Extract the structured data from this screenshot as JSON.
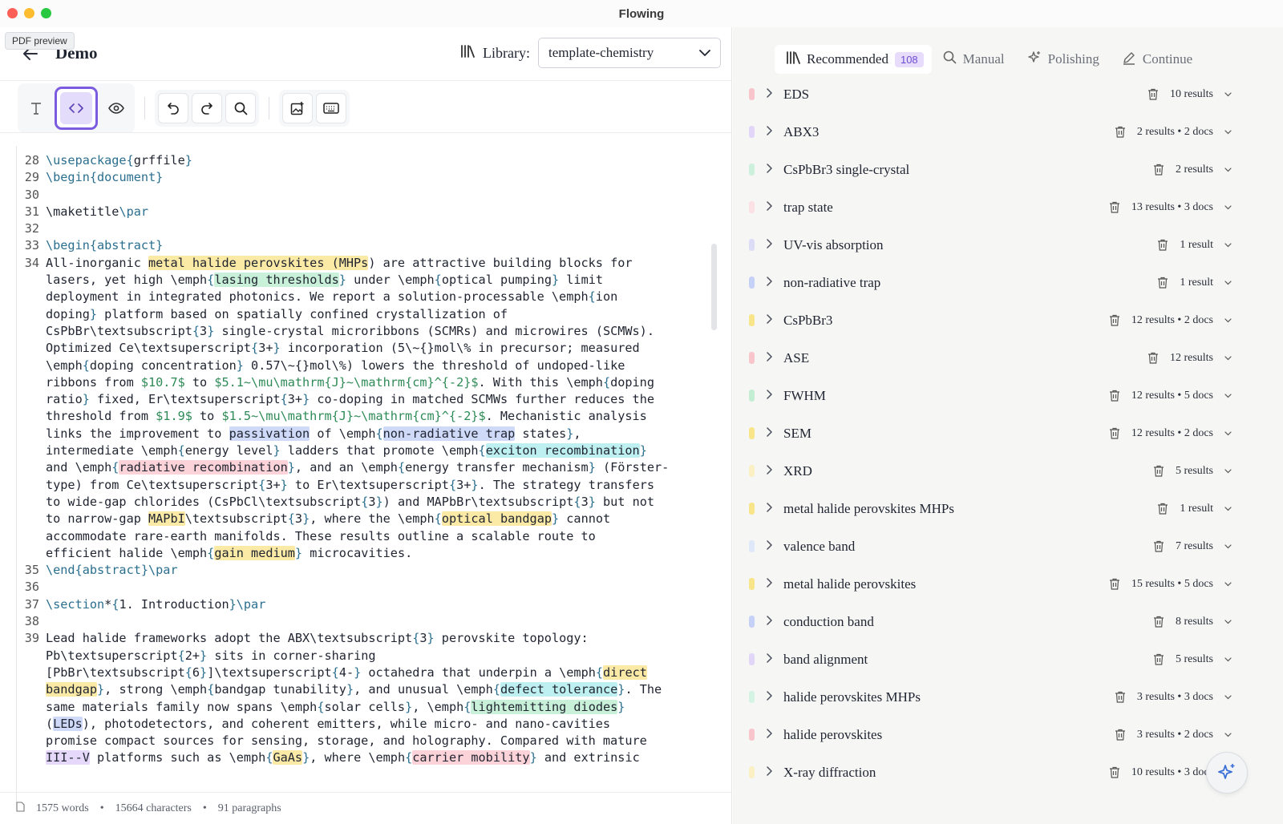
{
  "window": {
    "title": "Flowing"
  },
  "tooltip": "PDF preview",
  "header": {
    "title": "Demo",
    "library_label": "Library:",
    "library_value": "template-chemistry"
  },
  "status": {
    "words": "1575 words",
    "characters": "15664 characters",
    "paragraphs": "91 paragraphs",
    "separator": "•"
  },
  "tabs": [
    {
      "label": "Recommended",
      "badge": "108",
      "icon": "library-icon"
    },
    {
      "label": "Manual",
      "icon": "search-icon"
    },
    {
      "label": "Polishing",
      "icon": "sparkles-icon"
    },
    {
      "label": "Continue",
      "icon": "pen-icon"
    }
  ],
  "terms": [
    {
      "name": "EDS",
      "meta": "10 results",
      "color": "#f7c5cb"
    },
    {
      "name": "ABX3",
      "meta": "2 results • 2 docs",
      "color": "#e2d6f8"
    },
    {
      "name": "CsPbBr3 single-crystal",
      "meta": "2 results",
      "color": "#cdf0dc"
    },
    {
      "name": "trap state",
      "meta": "13 results • 3 docs",
      "color": "#fbe0e4"
    },
    {
      "name": "UV-vis absorption",
      "meta": "1 result",
      "color": "#dcdcf7"
    },
    {
      "name": "non-radiative trap",
      "meta": "1 result",
      "color": "#c5d1f6"
    },
    {
      "name": "CsPbBr3",
      "meta": "12 results • 2 docs",
      "color": "#f8e58a"
    },
    {
      "name": "ASE",
      "meta": "12 results",
      "color": "#f7c5cb"
    },
    {
      "name": "FWHM",
      "meta": "12 results • 5 docs",
      "color": "#c4eed3"
    },
    {
      "name": "SEM",
      "meta": "12 results • 2 docs",
      "color": "#f8e58a"
    },
    {
      "name": "XRD",
      "meta": "5 results",
      "color": "#fbf0c4"
    },
    {
      "name": "metal halide perovskites MHPs",
      "meta": "1 result",
      "color": "#f8e58a"
    },
    {
      "name": "valence band",
      "meta": "7 results",
      "color": "#dfe8f8"
    },
    {
      "name": "metal halide perovskites",
      "meta": "15 results • 5 docs",
      "color": "#f8e58a"
    },
    {
      "name": "conduction band",
      "meta": "8 results",
      "color": "#c5d1f6"
    },
    {
      "name": "band alignment",
      "meta": "5 results",
      "color": "#e2d6f8"
    },
    {
      "name": "halide perovskites MHPs",
      "meta": "3 results • 3 docs",
      "color": "#d4f3e2"
    },
    {
      "name": "halide perovskites",
      "meta": "3 results • 2 docs",
      "color": "#f7c5cb"
    },
    {
      "name": "X-ray diffraction",
      "meta": "10 results • 3 docs",
      "color": "#fbf0c4"
    }
  ],
  "code_lines": [
    {
      "n": "28",
      "html": "<span class=\"cmd\">\\usepackage</span><span class=\"cmd\">{</span>grffile<span class=\"cmd\">}</span>"
    },
    {
      "n": "29",
      "html": "<span class=\"cmd\">\\begin{</span><span class=\"cmd\">document</span><span class=\"cmd\">}</span>"
    },
    {
      "n": "30",
      "html": ""
    },
    {
      "n": "31",
      "html": "\\maketitle<span class=\"cmd\">\\par</span>"
    },
    {
      "n": "32",
      "html": ""
    },
    {
      "n": "33",
      "html": "<span class=\"cmd\">\\begin{</span><span class=\"cmd\">abstract</span><span class=\"cmd\">}</span>"
    },
    {
      "n": "34",
      "html": "All-inorganic <span class=\"hl hl-y\">metal halide perovskites (MHPs</span>) are attractive building blocks for"
    },
    {
      "n": "",
      "html": "lasers, yet high \\emph<span class=\"cmd\">{</span><span class=\"hl hl-g\">lasing thresholds</span><span class=\"cmd\">}</span> under \\emph<span class=\"cmd\">{</span>optical pumping<span class=\"cmd\">}</span> limit"
    },
    {
      "n": "",
      "html": "deployment in integrated photonics. We report a solution-processable \\emph<span class=\"cmd\">{</span>ion"
    },
    {
      "n": "",
      "html": "doping<span class=\"cmd\">}</span> platform based on spatially confined crystallization of"
    },
    {
      "n": "",
      "html": "CsPbBr\\textsubscript<span class=\"cmd\">{</span>3<span class=\"cmd\">}</span> single-crystal microribbons (SCMRs) and microwires (SCMWs)."
    },
    {
      "n": "",
      "html": "Optimized Ce\\textsuperscript<span class=\"cmd\">{</span>3+<span class=\"cmd\">}</span> incorporation (5\\~{}mol\\% in precursor; measured"
    },
    {
      "n": "",
      "html": "\\emph<span class=\"cmd\">{</span>doping concentration<span class=\"cmd\">}</span> 0.57\\~{}mol\\%) lowers the threshold of undoped-like"
    },
    {
      "n": "",
      "html": "ribbons from <span class=\"num\">$10.7$</span> to <span class=\"num\">$5.1~\\mu\\mathrm{J}~\\mathrm{cm}^{-2}$</span>. With this \\emph<span class=\"cmd\">{</span>doping"
    },
    {
      "n": "",
      "html": "ratio<span class=\"cmd\">}</span> fixed, Er\\textsuperscript<span class=\"cmd\">{</span>3+<span class=\"cmd\">}</span> co-doping in matched SCMWs further reduces the"
    },
    {
      "n": "",
      "html": "threshold from <span class=\"num\">$1.9$</span> to <span class=\"num\">$1.5~\\mu\\mathrm{J}~\\mathrm{cm}^{-2}$</span>. Mechanistic analysis"
    },
    {
      "n": "",
      "html": "links the improvement to <span class=\"hl hl-b\">passivation</span> of \\emph<span class=\"cmd\">{</span><span class=\"hl hl-b\">non-radiative trap</span> states<span class=\"cmd\">}</span>,"
    },
    {
      "n": "",
      "html": "intermediate \\emph<span class=\"cmd\">{</span>energy level<span class=\"cmd\">}</span> ladders that promote \\emph<span class=\"cmd\">{</span><span class=\"hl hl-c\">exciton recombination</span><span class=\"cmd\">}</span>"
    },
    {
      "n": "",
      "html": "and \\emph<span class=\"cmd\">{</span><span class=\"hl hl-r\">radiative recombination</span><span class=\"cmd\">}</span>, and an \\emph<span class=\"cmd\">{</span>energy transfer mechanism<span class=\"cmd\">}</span> (Förster-"
    },
    {
      "n": "",
      "html": "type) from Ce\\textsuperscript<span class=\"cmd\">{</span>3+<span class=\"cmd\">}</span> to Er\\textsuperscript<span class=\"cmd\">{</span>3+<span class=\"cmd\">}</span>. The strategy transfers"
    },
    {
      "n": "",
      "html": "to wide-gap chlorides (CsPbCl\\textsubscript<span class=\"cmd\">{</span>3<span class=\"cmd\">}</span>) and MAPbBr\\textsubscript<span class=\"cmd\">{</span>3<span class=\"cmd\">}</span> but not"
    },
    {
      "n": "",
      "html": "to narrow-gap <span class=\"hl hl-y\">MAPbI</span>\\textsubscript<span class=\"cmd\">{</span>3<span class=\"cmd\">}</span>, where the \\emph<span class=\"cmd\">{</span><span class=\"hl hl-y\">optical bandgap</span><span class=\"cmd\">}</span> cannot"
    },
    {
      "n": "",
      "html": "accommodate rare-earth manifolds. These results outline a scalable route to"
    },
    {
      "n": "",
      "html": "efficient halide \\emph<span class=\"cmd\">{</span><span class=\"hl hl-y\">gain medium</span><span class=\"cmd\">}</span> microcavities."
    },
    {
      "n": "35",
      "html": "<span class=\"cmd\">\\end{</span><span class=\"cmd\">abstract</span><span class=\"cmd\">}\\par</span>"
    },
    {
      "n": "36",
      "html": ""
    },
    {
      "n": "37",
      "html": "<span class=\"cmd\">\\section</span>*<span class=\"cmd\">{</span>1. Introduction<span class=\"cmd\">}\\par</span>"
    },
    {
      "n": "38",
      "html": ""
    },
    {
      "n": "39",
      "html": "Lead halide frameworks adopt the ABX\\textsubscript<span class=\"cmd\">{</span>3<span class=\"cmd\">}</span> perovskite topology:"
    },
    {
      "n": "",
      "html": "Pb\\textsuperscript<span class=\"cmd\">{</span>2+<span class=\"cmd\">}</span> sits in corner-sharing"
    },
    {
      "n": "",
      "html": "[PbBr\\textsubscript<span class=\"cmd\">{</span>6<span class=\"cmd\">}</span>]\\textsuperscript<span class=\"cmd\">{</span>4-<span class=\"cmd\">}</span> octahedra that underpin a \\emph<span class=\"cmd\">{</span><span class=\"hl hl-y\">direct</span>"
    },
    {
      "n": "",
      "html": "<span class=\"hl hl-y\">bandgap</span><span class=\"cmd\">}</span>, strong \\emph<span class=\"cmd\">{</span>bandgap tunability<span class=\"cmd\">}</span>, and unusual \\emph<span class=\"cmd\">{</span><span class=\"hl hl-c\">defect tolerance</span><span class=\"cmd\">}</span>. The"
    },
    {
      "n": "",
      "html": "same materials family now spans \\emph<span class=\"cmd\">{</span>solar cells<span class=\"cmd\">}</span>, \\emph<span class=\"cmd\">{</span><span class=\"hl hl-g\">lightemitting diodes</span><span class=\"cmd\">}</span>"
    },
    {
      "n": "",
      "html": "(<span class=\"hl hl-b\">LEDs</span>), photodetectors, and coherent emitters, while micro- and nano-cavities"
    },
    {
      "n": "",
      "html": "promise compact sources for sensing, storage, and holography. Compared with mature"
    },
    {
      "n": "",
      "html": "<span class=\"hl hl-p\">III--V</span> platforms such as \\emph<span class=\"cmd\">{</span><span class=\"hl hl-y\">GaAs</span><span class=\"cmd\">}</span>, where \\emph<span class=\"cmd\">{</span><span class=\"hl hl-r\">carrier mobility</span><span class=\"cmd\">}</span> and extrinsic"
    }
  ]
}
